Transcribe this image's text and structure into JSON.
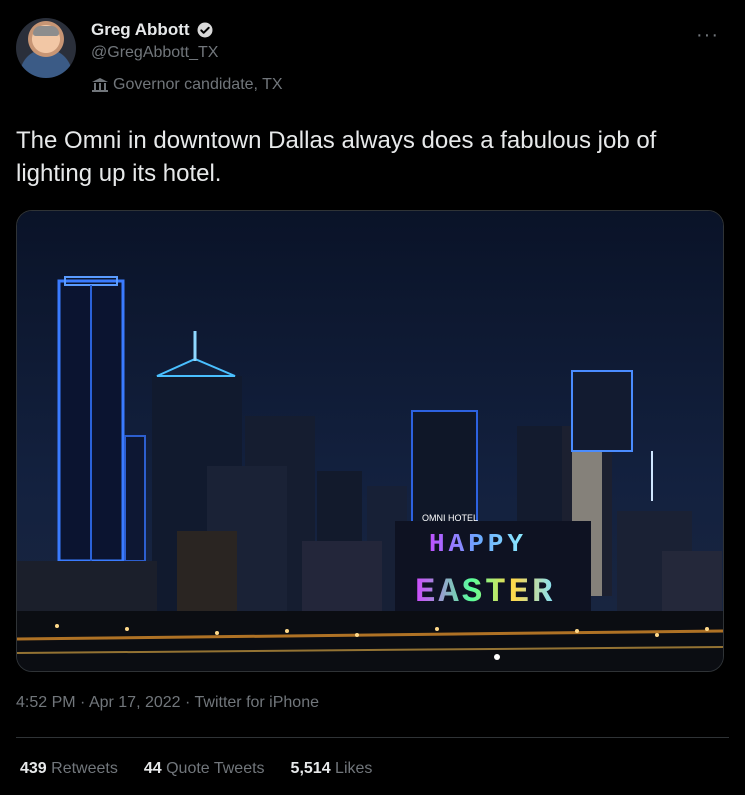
{
  "author": {
    "name": "Greg Abbott",
    "handle": "@GregAbbott_TX",
    "label": "Governor candidate, TX"
  },
  "menu_glyph": "···",
  "tweet": {
    "text": "The Omni in downtown Dallas always does a fabulous job of lighting up its hotel."
  },
  "media": {
    "hotel_sign": "OMNI HOTEL",
    "display_line1": "HAPPY",
    "display_line2": "EASTER",
    "sky_color": "#0f1a33",
    "accent_blue": "#3a7bff"
  },
  "meta": {
    "time": "4:52 PM",
    "sep1": "·",
    "date": "Apr 17, 2022",
    "sep2": "·",
    "source": "Twitter for iPhone"
  },
  "stats": {
    "retweets_count": "439",
    "retweets_label": "Retweets",
    "quotes_count": "44",
    "quotes_label": "Quote Tweets",
    "likes_count": "5,514",
    "likes_label": "Likes"
  }
}
